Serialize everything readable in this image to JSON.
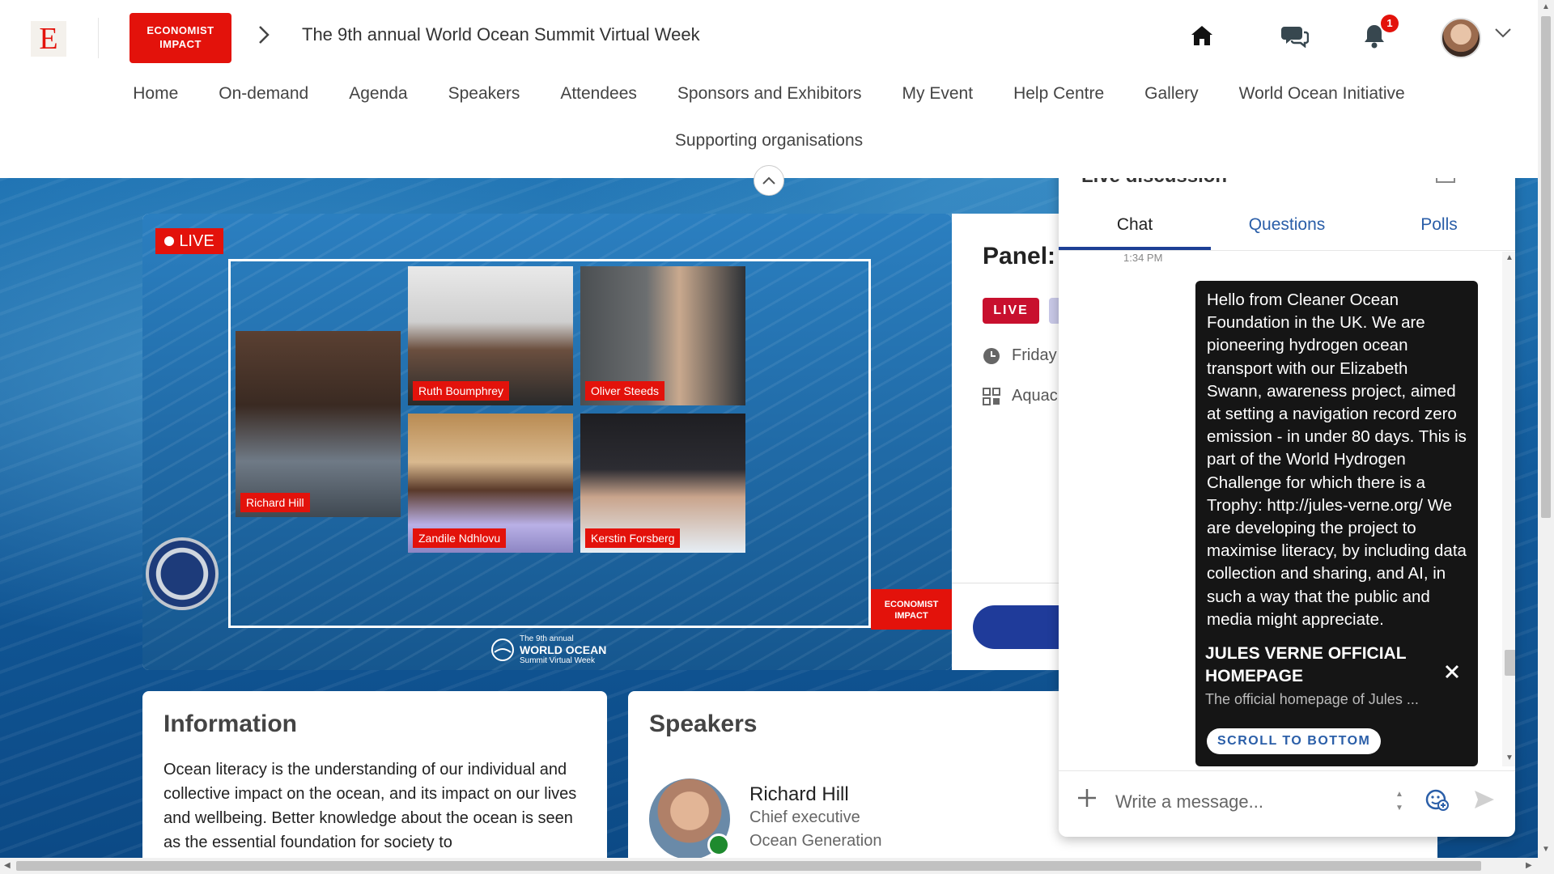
{
  "header": {
    "logo_letter": "E",
    "brand_badge_line1": "ECONOMIST",
    "brand_badge_line2": "IMPACT",
    "event_title": "The 9th annual World Ocean Summit Virtual Week",
    "notification_count": "1"
  },
  "nav": {
    "row1": [
      "Home",
      "On-demand",
      "Agenda",
      "Speakers",
      "Attendees",
      "Sponsors and Exhibitors",
      "My Event",
      "Help Centre",
      "Gallery",
      "World Ocean Initiative"
    ],
    "row2": [
      "Supporting organisations"
    ]
  },
  "video": {
    "live_label": "LIVE",
    "participants": [
      "Richard Hill",
      "Ruth Boumphrey",
      "Oliver Steeds",
      "Zandile Ndhlovu",
      "Kerstin Forsberg"
    ],
    "corner_badge_line1": "ECONOMIST",
    "corner_badge_line2": "IMPACT",
    "logo_small": "The 9th annual",
    "logo_main": "WORLD OCEAN",
    "logo_sub": "Summit Virtual Week"
  },
  "session": {
    "title": "Panel:",
    "live_pill": "LIVE",
    "date": "Friday",
    "location": "Aquac"
  },
  "information": {
    "heading": "Information",
    "text": "Ocean literacy is the understanding of our individual and collective impact on the ocean, and its impact on our lives and wellbeing. Better knowledge about the ocean is seen as the essential foundation for society to"
  },
  "speakers": {
    "heading": "Speakers",
    "items": [
      {
        "name": "Richard Hill",
        "title": "Chief executive",
        "org": "Ocean Generation"
      }
    ]
  },
  "chat": {
    "title": "Live discussion",
    "tabs": [
      "Chat",
      "Questions",
      "Polls"
    ],
    "active_tab": "Chat",
    "message_time": "1:34 PM",
    "message_text": "Hello from Cleaner Ocean Foundation in the UK. We are pioneering hydrogen ocean transport with our Elizabeth Swann, awareness project, aimed at setting a navigation record zero emission - in under 80 days. This is part of the World Hydrogen Challenge for which there is a Trophy: http://jules-verne.org/ We are developing the project to maximise literacy, by including data collection and sharing, and AI, in such a way that the public and media might appreciate.",
    "link_preview_title": "JULES VERNE OFFICIAL HOMEPAGE",
    "link_preview_desc": "The official homepage of Jules ...",
    "scroll_to_bottom": "SCROLL TO BOTTOM",
    "input_placeholder": "Write a message..."
  },
  "colors": {
    "brand_red": "#e3120b",
    "nav_blue": "#1c3f95",
    "link_blue": "#2a5ea8",
    "online_green": "#1e8a2e"
  },
  "icons": [
    "home-icon",
    "chat-bubbles-icon",
    "bell-icon",
    "chevron-down-icon",
    "chevron-right-icon",
    "chevron-up-icon",
    "clock-icon",
    "grid-icon",
    "plus-icon",
    "emoji-icon",
    "send-icon",
    "close-icon",
    "popout-icon"
  ]
}
